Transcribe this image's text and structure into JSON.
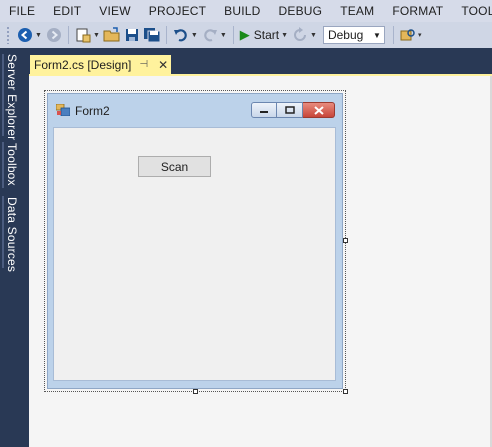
{
  "menu": [
    "FILE",
    "EDIT",
    "VIEW",
    "PROJECT",
    "BUILD",
    "DEBUG",
    "TEAM",
    "FORMAT",
    "TOOLS"
  ],
  "toolbar": {
    "start_label": "Start",
    "configuration": "Debug"
  },
  "side_tabs": [
    "Server Explorer",
    "Toolbox",
    "Data Sources"
  ],
  "document_tab": {
    "title": "Form2.cs [Design]"
  },
  "form": {
    "title": "Form2",
    "button_label": "Scan"
  },
  "colors": {
    "ide_background": "#293955",
    "active_tab": "#fff29d",
    "menubar": "#d6dbe9",
    "designer_surface": "#f5f5f5"
  }
}
